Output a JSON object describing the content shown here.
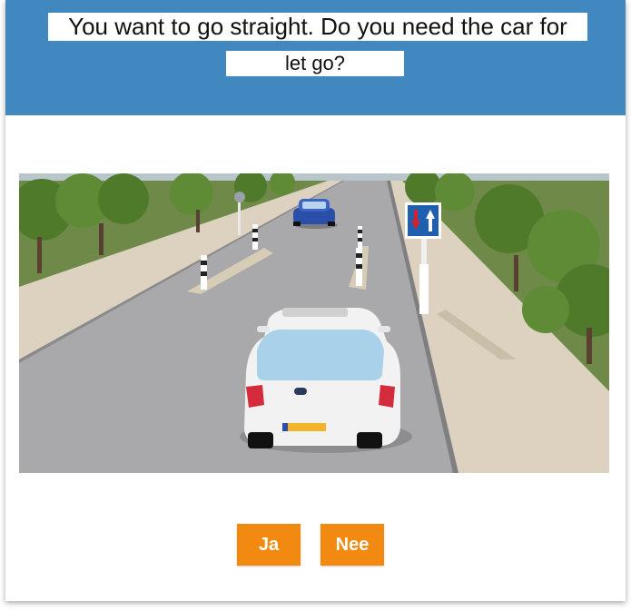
{
  "question": {
    "line1": "You want to go straight. Do you need the car for",
    "line2": "let go?"
  },
  "answers": [
    {
      "label": "Ja"
    },
    {
      "label": "Nee"
    }
  ],
  "colors": {
    "header": "#4288c0",
    "answer_button": "#f28a11",
    "answer_text": "#ffffff"
  },
  "scene": {
    "sign_icon": "priority-over-oncoming-traffic-sign",
    "vehicles": [
      "white-hatchback-car",
      "blue-sedan-car"
    ]
  }
}
